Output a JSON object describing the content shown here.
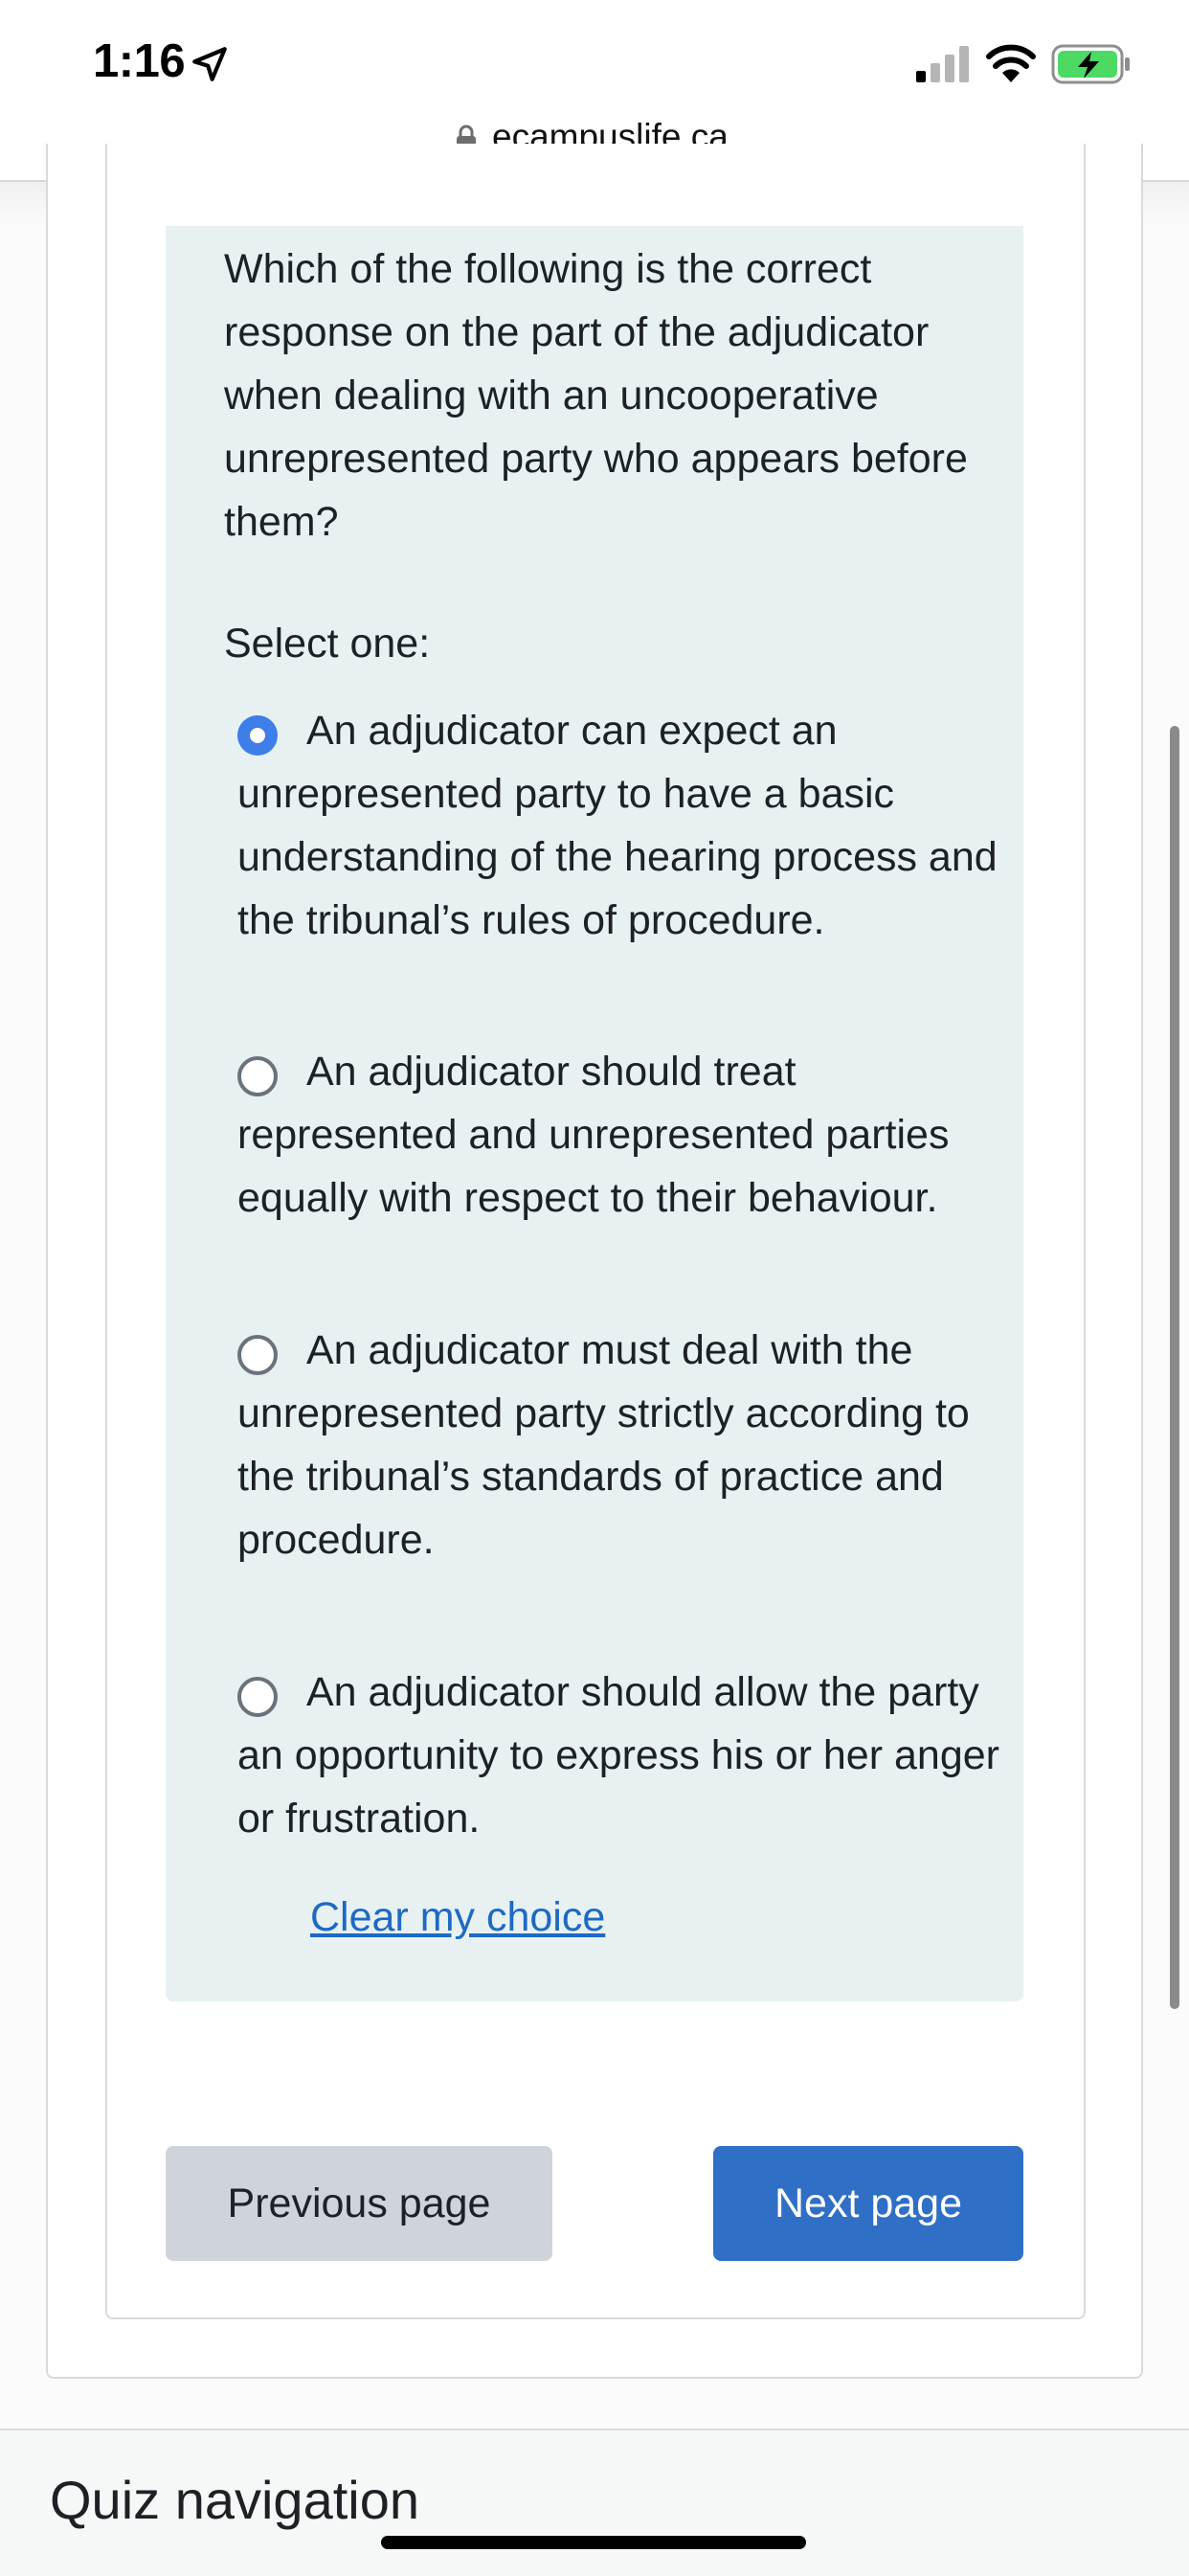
{
  "status_bar": {
    "time": "1:16",
    "icons": [
      "location-arrow-icon",
      "cellular-signal-icon",
      "wifi-icon",
      "battery-charging-icon"
    ]
  },
  "browser": {
    "url": "ecampuslife.ca",
    "secure": true
  },
  "question": {
    "text": "Which of the following is the correct response on the part of the adjudicator when dealing with an uncooperative unrepresented party who appears before them?",
    "instruction": "Select one:",
    "options": [
      {
        "label": "An adjudicator can expect an unrepresented party to have a basic understanding of the hearing process and the tribunal’s rules of procedure.",
        "selected": true
      },
      {
        "label": "An adjudicator should treat represented and unrepresented parties equally with respect to their behaviour.",
        "selected": false
      },
      {
        "label": "An adjudicator must deal with the unrepresented party strictly according to the tribunal’s standards of practice and procedure.",
        "selected": false
      },
      {
        "label": "An adjudicator should allow the party an opportunity to express his or her anger or frustration.",
        "selected": false
      }
    ],
    "clear_choice_label": "Clear my choice"
  },
  "navigation": {
    "previous_label": "Previous page",
    "next_label": "Next page"
  },
  "quiz_navigation": {
    "title": "Quiz navigation"
  },
  "colors": {
    "accent": "#2f6fc6",
    "radio_selected": "#3d7ee8",
    "question_background": "#e7f1f2",
    "link": "#1d69c4",
    "secondary_button": "#ced4da"
  }
}
